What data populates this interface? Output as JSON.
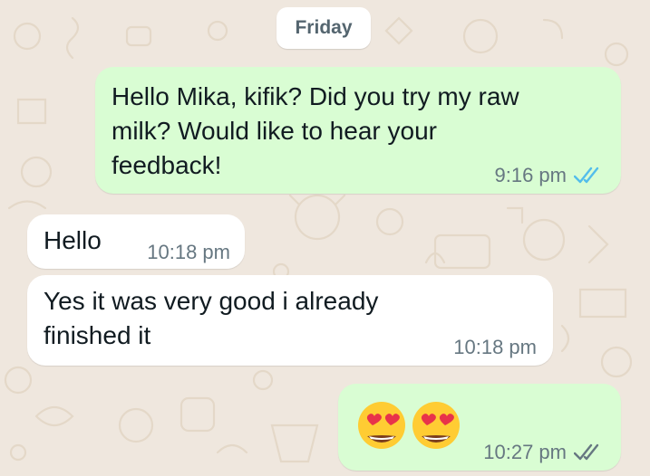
{
  "chat": {
    "date_separator": "Friday",
    "messages": [
      {
        "direction": "outgoing",
        "text": "Hello Mika, kifik? Did you try my raw milk? Would like to hear your feedback!",
        "time": "9:16 pm",
        "status": "read",
        "status_icon": "double-check-icon",
        "status_color": "#53bdeb"
      },
      {
        "direction": "incoming",
        "text": "Hello",
        "time": "10:18 pm"
      },
      {
        "direction": "incoming",
        "text": "Yes it was very good i already finished it",
        "time": "10:18 pm"
      },
      {
        "direction": "outgoing",
        "text": "😍😍",
        "emoji": [
          "heart-eyes-emoji",
          "heart-eyes-emoji"
        ],
        "time": "10:27 pm",
        "status": "delivered",
        "status_icon": "double-check-icon",
        "status_color": "#667781"
      }
    ]
  },
  "colors": {
    "wallpaper": "#efe7de",
    "outgoing_bubble": "#d9fdd3",
    "incoming_bubble": "#ffffff",
    "timestamp": "#667781",
    "read_ticks": "#53bdeb"
  }
}
